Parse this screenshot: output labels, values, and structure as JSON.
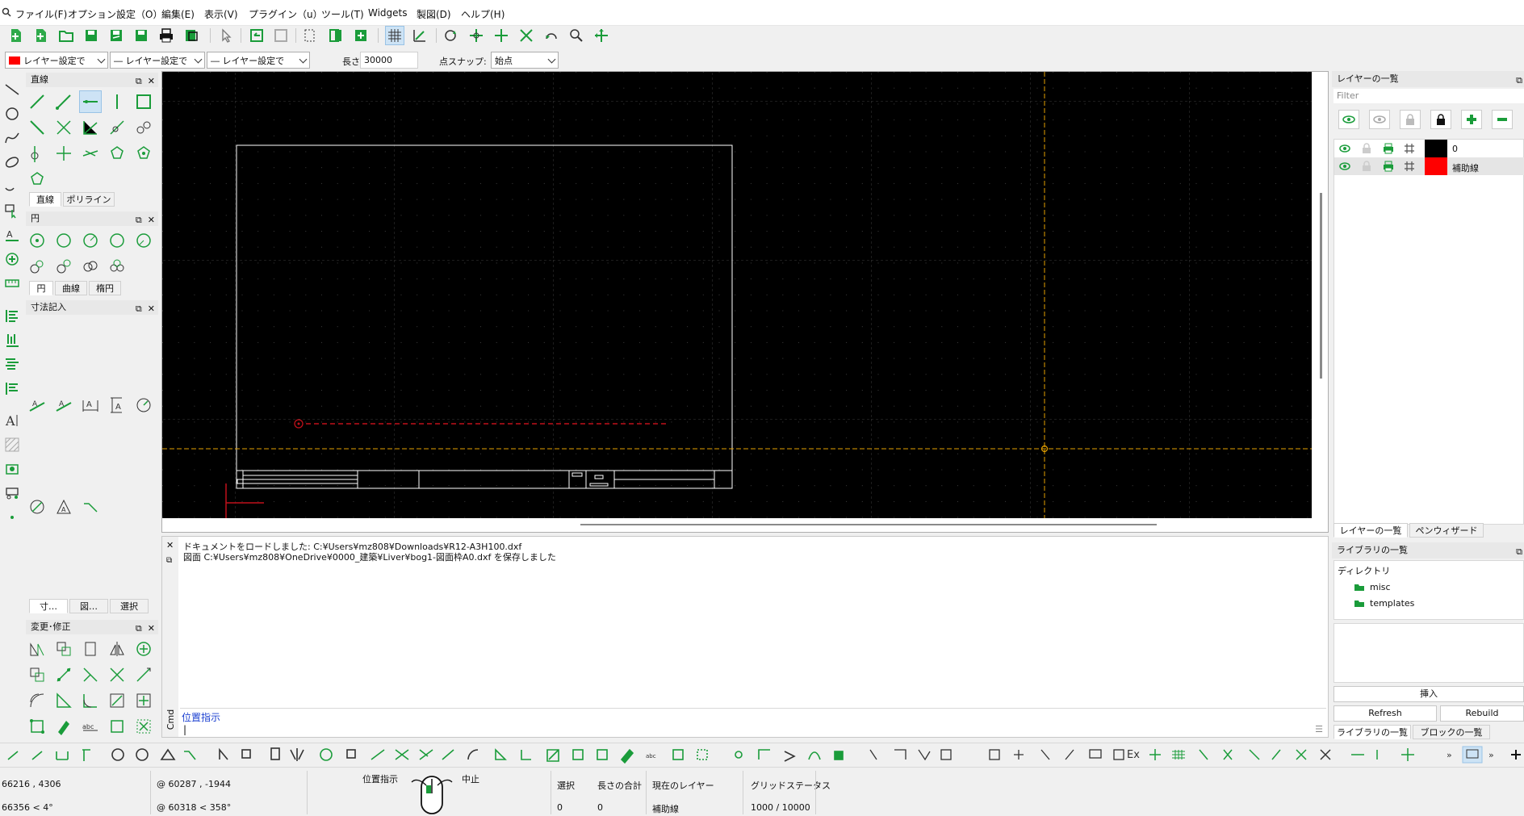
{
  "menu": {
    "items": [
      "ファイル(F)",
      "オプション設定（O）",
      "編集(E)",
      "表示(V)",
      "プラグイン（u）",
      "ツール(T)",
      "Widgets",
      "製図(D)",
      "ヘルプ(H)"
    ]
  },
  "pen_toolbar": {
    "color_combo": "レイヤー設定で",
    "width_combo": "― レイヤー設定で",
    "type_combo": "― レイヤー設定で",
    "length_label": "長さ:",
    "length_value": "30000",
    "snap_label": "点スナップ:",
    "snap_value": "始点"
  },
  "left_docks": {
    "line_title": "直線",
    "line_tabs": [
      "直線",
      "ポリライン"
    ],
    "circle_title": "円",
    "circle_tabs": [
      "円",
      "曲線",
      "楕円"
    ],
    "dimension_title": "寸法記入",
    "lower_tabs": [
      "寸…",
      "図…",
      "選択"
    ],
    "modify_title": "変更･修正"
  },
  "command": {
    "history": [
      "ドキュメントをロードしました: C:¥Users¥mz808¥Downloads¥R12-A3H100.dxf",
      "図面 C:¥Users¥mz808¥OneDrive¥0000_建築¥Liver¥bog1-図面枠A0.dxf を保存しました"
    ],
    "prompt": "位置指示",
    "input_value": "|",
    "side_label": "Cmd"
  },
  "layers_panel": {
    "title": "レイヤーの一覧",
    "filter_placeholder": "Filter",
    "layers": [
      {
        "name": "0",
        "color": "#000000"
      },
      {
        "name": "補助線",
        "color": "#ff0000"
      }
    ],
    "tabs": [
      "レイヤーの一覧",
      "ペンウィザード"
    ]
  },
  "library_panel": {
    "title": "ライブラリの一覧",
    "header": "ディレクトリ",
    "folders": [
      "misc",
      "templates"
    ],
    "insert_label": "挿入",
    "refresh_label": "Refresh",
    "rebuild_label": "Rebuild",
    "tabs": [
      "ライブラリの一覧",
      "ブロックの一覧"
    ]
  },
  "bottom_toolbar": {
    "ex_label": "Ex"
  },
  "status": {
    "abs_coord": "66216 , 4306",
    "abs_polar": "66356 < 4°",
    "rel_coord": "@  60287 , -1944",
    "rel_polar": "@  60318 < 358°",
    "mouse_left": "位置指示",
    "mouse_right": "中止",
    "selection_label": "選択",
    "selection_value": "0",
    "length_label": "長さの合計",
    "length_value": "0",
    "layer_label": "現在のレイヤー",
    "layer_value": "補助線",
    "grid_label": "グリッドステータス",
    "grid_value": "1000 / 10000"
  },
  "colors": {
    "accent_green": "#1a9c3a",
    "canvas_bg": "#000000",
    "crosshair": "#e5a100",
    "aux_line": "#c0101a"
  }
}
